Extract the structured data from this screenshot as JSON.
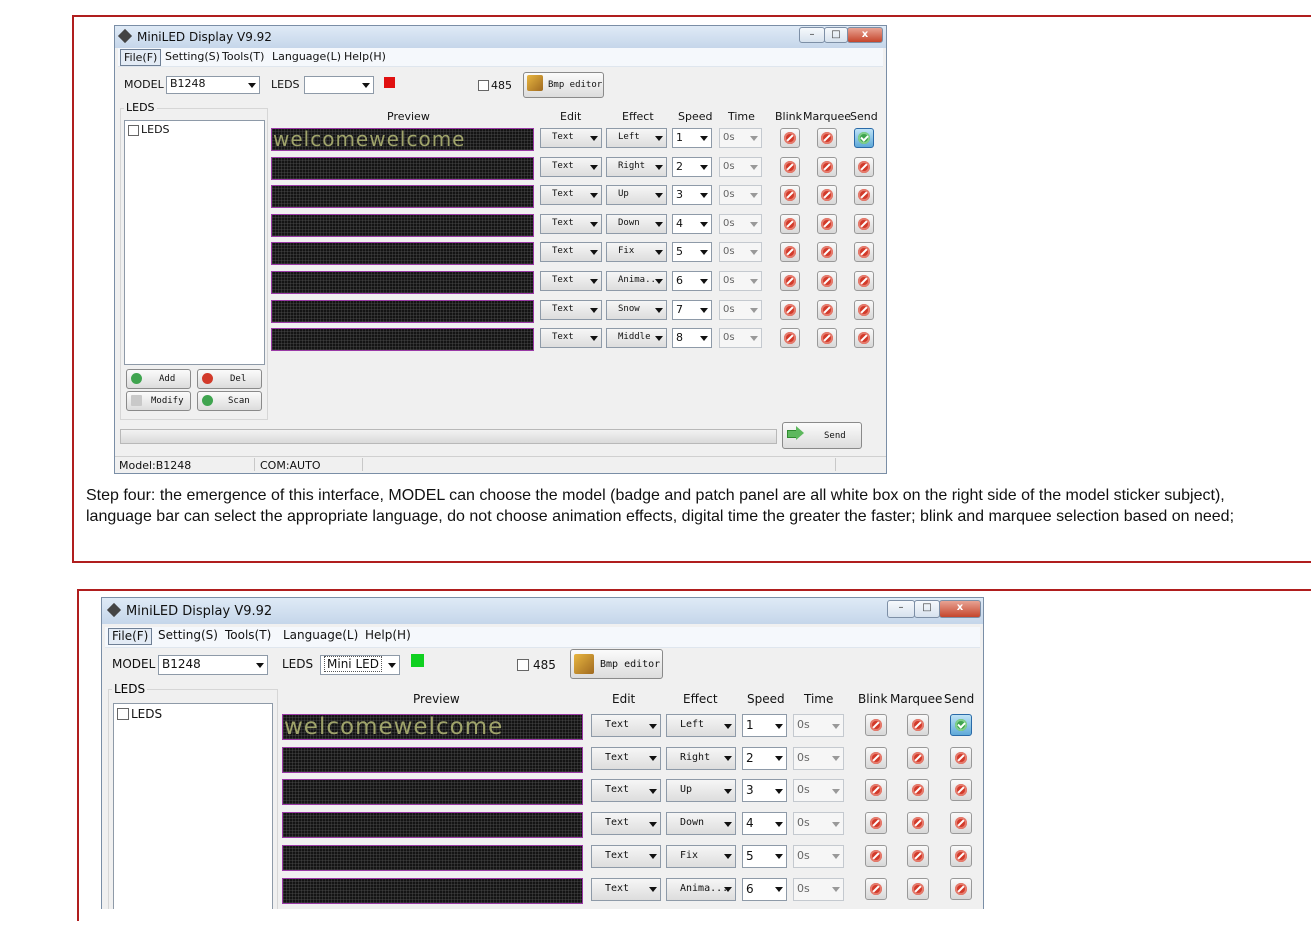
{
  "screen1": {
    "window_title": "MiniLED Display V9.92",
    "menu": [
      "File(F)",
      "Setting(S)",
      "Tools(T)",
      "Language(L)",
      "Help(H)"
    ],
    "model_label": "MODEL",
    "model_value": "B1248",
    "leds_label": "LEDS",
    "leds_value": "",
    "leds_color": "#e01010",
    "rs485_label": "485",
    "bmp_editor_label": "Bmp editor",
    "leds_group_label": "LEDS",
    "leds_check_label": "LEDS",
    "col_preview": "Preview",
    "col_edit": "Edit",
    "col_effect": "Effect",
    "col_speed": "Speed",
    "col_time": "Time",
    "col_blink": "Blink",
    "col_marquee": "Marquee",
    "col_send": "Send",
    "add_label": "Add",
    "del_label": "Del",
    "modify_label": "Modify",
    "scan_label": "Scan",
    "send_label": "Send",
    "status_model": "Model:B1248",
    "status_com": "COM:AUTO",
    "rows": [
      {
        "preview": "welcomewelcome",
        "edit": "Text",
        "effect": "Left",
        "speed": "1",
        "time": "0s"
      },
      {
        "preview": "",
        "edit": "Text",
        "effect": "Right",
        "speed": "2",
        "time": "0s"
      },
      {
        "preview": "",
        "edit": "Text",
        "effect": "Up",
        "speed": "3",
        "time": "0s"
      },
      {
        "preview": "",
        "edit": "Text",
        "effect": "Down",
        "speed": "4",
        "time": "0s"
      },
      {
        "preview": "",
        "edit": "Text",
        "effect": "Fix",
        "speed": "5",
        "time": "0s"
      },
      {
        "preview": "",
        "edit": "Text",
        "effect": "Anima...",
        "speed": "6",
        "time": "0s"
      },
      {
        "preview": "",
        "edit": "Text",
        "effect": "Snow",
        "speed": "7",
        "time": "0s"
      },
      {
        "preview": "",
        "edit": "Text",
        "effect": "Middle",
        "speed": "8",
        "time": "0s"
      }
    ]
  },
  "caption": "Step four: the emergence of this interface, MODEL can choose the model (badge and patch panel are all white box on the right side of the model sticker subject), language bar can select the appropriate language, do not choose animation effects, digital time the greater the faster; blink and marquee selection based on need;",
  "screen2": {
    "window_title": "MiniLED Display V9.92",
    "menu": [
      "File(F)",
      "Setting(S)",
      "Tools(T)",
      "Language(L)",
      "Help(H)"
    ],
    "model_label": "MODEL",
    "model_value": "B1248",
    "leds_label": "LEDS",
    "leds_value": "Mini LED",
    "leds_color": "#10d020",
    "rs485_label": "485",
    "bmp_editor_label": "Bmp editor",
    "leds_group_label": "LEDS",
    "leds_check_label": "LEDS",
    "col_preview": "Preview",
    "col_edit": "Edit",
    "col_effect": "Effect",
    "col_speed": "Speed",
    "col_time": "Time",
    "col_blink": "Blink",
    "col_marquee": "Marquee",
    "col_send": "Send",
    "rows": [
      {
        "preview": "welcomewelcome",
        "edit": "Text",
        "effect": "Left",
        "speed": "1",
        "time": "0s"
      },
      {
        "preview": "",
        "edit": "Text",
        "effect": "Right",
        "speed": "2",
        "time": "0s"
      },
      {
        "preview": "",
        "edit": "Text",
        "effect": "Up",
        "speed": "3",
        "time": "0s"
      },
      {
        "preview": "",
        "edit": "Text",
        "effect": "Down",
        "speed": "4",
        "time": "0s"
      },
      {
        "preview": "",
        "edit": "Text",
        "effect": "Fix",
        "speed": "5",
        "time": "0s"
      },
      {
        "preview": "",
        "edit": "Text",
        "effect": "Anima...",
        "speed": "6",
        "time": "0s"
      }
    ]
  }
}
